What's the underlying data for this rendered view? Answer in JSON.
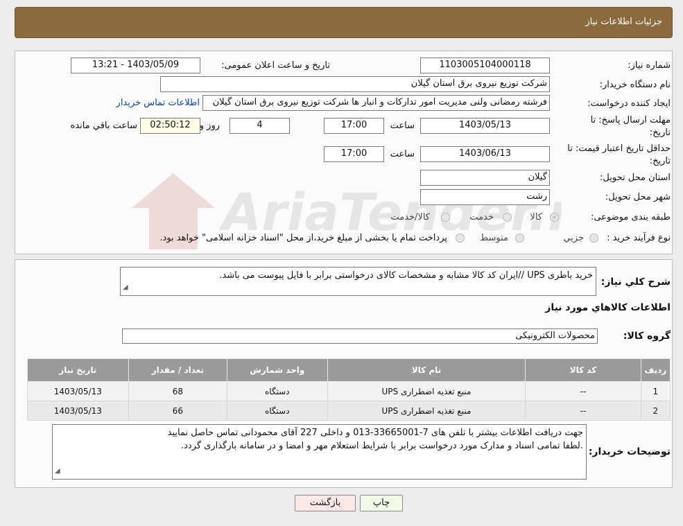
{
  "header": {
    "title": "جزئیات اطلاعات نیاز"
  },
  "form": {
    "need_number_label": "شماره نیاز:",
    "need_number": "1103005104000118",
    "announce_label": "تاریخ و ساعت اعلان عمومی:",
    "announce_value": "1403/05/09 - 13:21",
    "buyer_org_label": "نام دستگاه خریدار:",
    "buyer_org": "شرکت توزیع نیروی برق استان گیلان",
    "requester_label": "ایجاد کننده درخواست:",
    "requester": "فرشته رمضانی ولنی مدیریت امور تدارکات و انبار ها شرکت توزیع نیروی برق استان گیلان",
    "contact_link": "اطلاعات تماس خریدار",
    "deadline_label_1": "مهلت ارسال پاسخ: تا",
    "deadline_label_2": "تاریخ:",
    "deadline_date": "1403/05/13",
    "time_label": "ساعت",
    "deadline_time": "17:00",
    "days": "4",
    "days_label": "روز و",
    "remaining": "02:50:12",
    "remaining_label": "ساعت باقي مانده",
    "validity_label_1": "حداقل تاریخ اعتبار قیمت: تا",
    "validity_label_2": "تاریخ:",
    "validity_date": "1403/06/13",
    "validity_time": "17:00",
    "province_label": "استان محل تحویل:",
    "province": "گیلان",
    "city_label": "شهر محل تحویل:",
    "city": "رشت",
    "category_label": "طبقه بندی موضوعی:",
    "category_options": [
      "کالا",
      "خدمت",
      "کالا/خدمت"
    ],
    "process_label": "نوع فرآیند خرید :",
    "process_options": [
      "جزیي",
      "متوسط"
    ],
    "process_note": "پرداخت تمام یا بخشی از مبلغ خرید،از محل \"اسناد خزانه اسلامی\" خواهد بود."
  },
  "details": {
    "summary_label": "شرح کلي نیاز:",
    "summary": "خرید باطری UPS //ایران کد کالا مشابه و مشخصات کالای درخواستی برابر با فایل پیوست می باشد.",
    "goods_info_title": "اطلاعات کالاهاي مورد نیاز",
    "group_label": "گروه کالا:",
    "group": "محصولات الکترونیکی",
    "table": {
      "headers": [
        "ردیف",
        "کد کالا",
        "نام کالا",
        "واحد شمارش",
        "تعداد / مقدار",
        "تاریخ نیاز"
      ],
      "rows": [
        [
          "1",
          "--",
          "منبع تغذیه اضطراری UPS",
          "دستگاه",
          "68",
          "1403/05/13"
        ],
        [
          "2",
          "--",
          "منبع تغذیه اضطراری UPS",
          "دستگاه",
          "66",
          "1403/05/13"
        ]
      ]
    },
    "notes_label": "توضیحات خریدار:",
    "notes_line1": "جهت دریافت اطلاعات بیشتر با تلفن های 7-33665001-013 و داخلی 227 آقای محمودانی تماس حاصل نمایید",
    "notes_line2": ".لطفا تمامی اسناد و مدارک مورد درخواست برابر با شرایط استعلام مهر و امضا و در سامانه بارگذاری گردد."
  },
  "buttons": {
    "print": "چاپ",
    "back": "بازگشت"
  },
  "watermark": "AriaTender.neT",
  "colors": {
    "header": "#8b6a3e",
    "table_header": "#9a9a9a",
    "link": "#0645ad"
  }
}
